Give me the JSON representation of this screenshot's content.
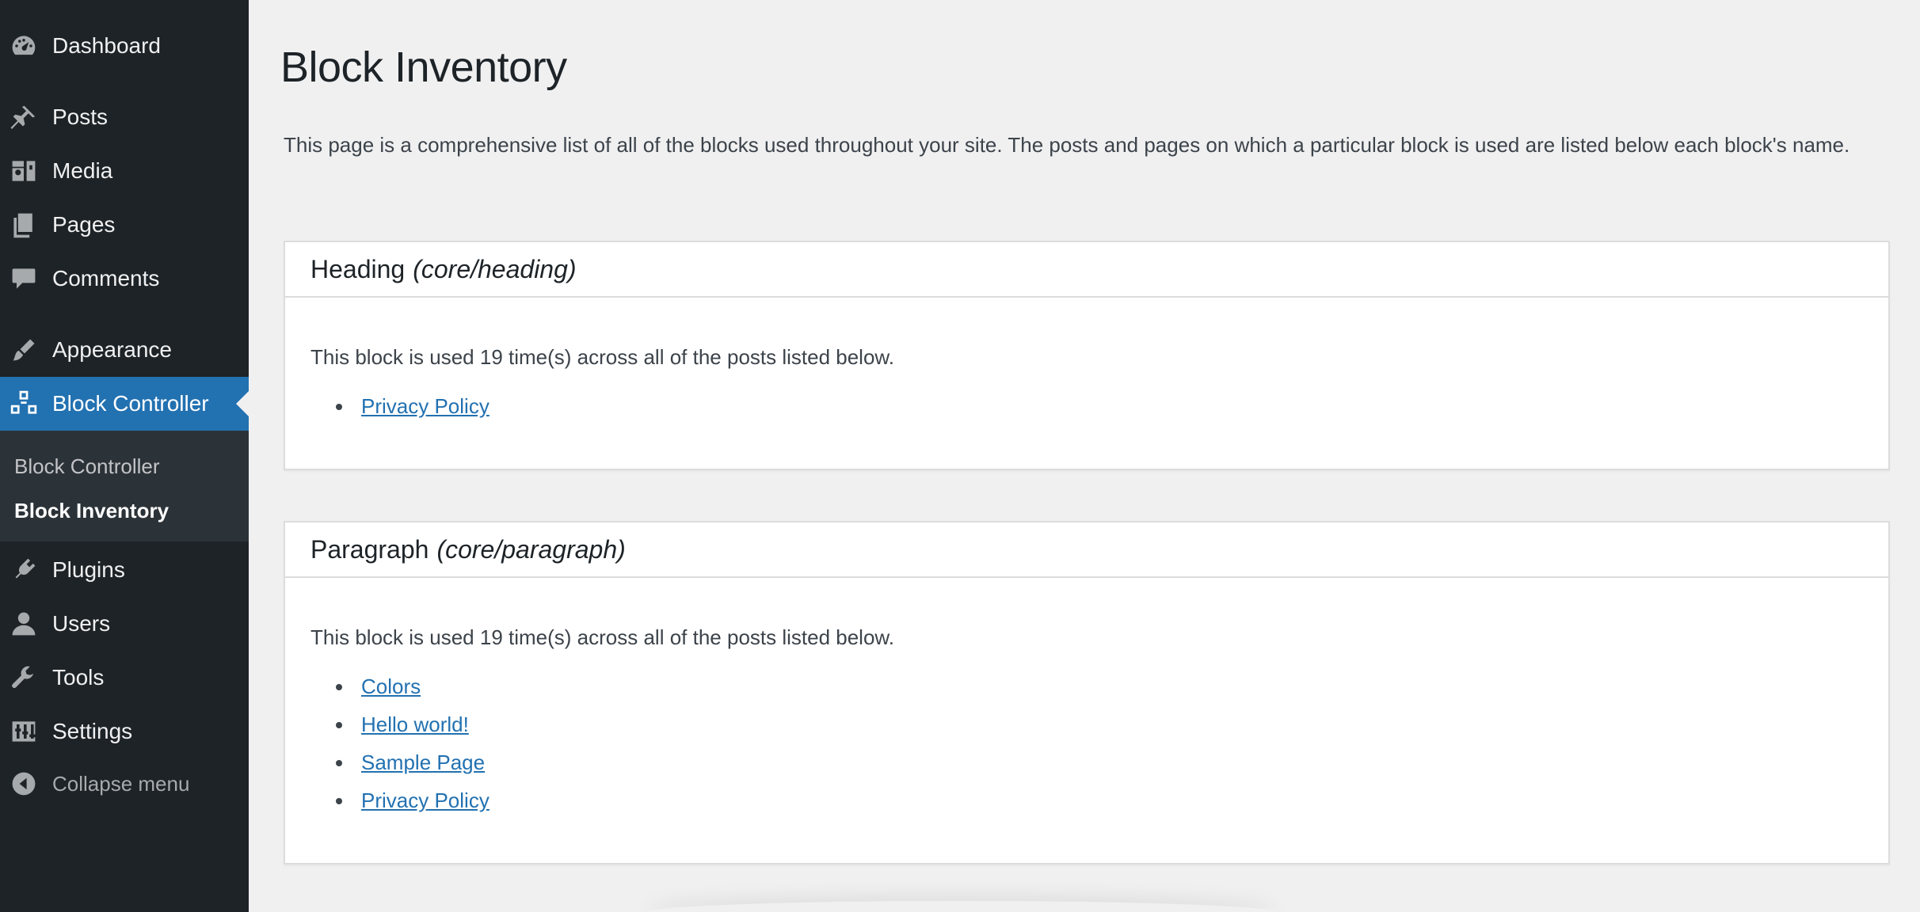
{
  "sidebar": {
    "items": [
      {
        "label": "Dashboard",
        "icon": "dashboard-icon"
      },
      {
        "label": "Posts",
        "icon": "pin-icon"
      },
      {
        "label": "Media",
        "icon": "media-icon"
      },
      {
        "label": "Pages",
        "icon": "pages-icon"
      },
      {
        "label": "Comments",
        "icon": "comment-icon"
      },
      {
        "label": "Appearance",
        "icon": "brush-icon"
      },
      {
        "label": "Block Controller",
        "icon": "blocks-icon"
      },
      {
        "label": "Plugins",
        "icon": "plugin-icon"
      },
      {
        "label": "Users",
        "icon": "user-icon"
      },
      {
        "label": "Tools",
        "icon": "wrench-icon"
      },
      {
        "label": "Settings",
        "icon": "settings-icon"
      }
    ],
    "submenu": [
      "Block Controller",
      "Block Inventory"
    ],
    "collapse_label": "Collapse menu"
  },
  "page": {
    "title": "Block Inventory",
    "intro": "This page is a comprehensive list of all of the blocks used throughout your site. The posts and pages on which a particular block is used are listed below each block's name."
  },
  "blocks": [
    {
      "name": "Heading",
      "slug": "(core/heading)",
      "usage": "This block is used 19 time(s) across all of the posts listed below.",
      "posts": [
        "Privacy Policy"
      ]
    },
    {
      "name": "Paragraph",
      "slug": "(core/paragraph)",
      "usage": "This block is used 19 time(s) across all of the posts listed below.",
      "posts": [
        "Colors",
        "Hello world!",
        "Sample Page",
        "Privacy Policy"
      ]
    }
  ],
  "colors": {
    "sidebar_bg": "#1d2327",
    "submenu_bg": "#2c3338",
    "accent": "#2271b1",
    "page_bg": "#f0f0f1"
  }
}
